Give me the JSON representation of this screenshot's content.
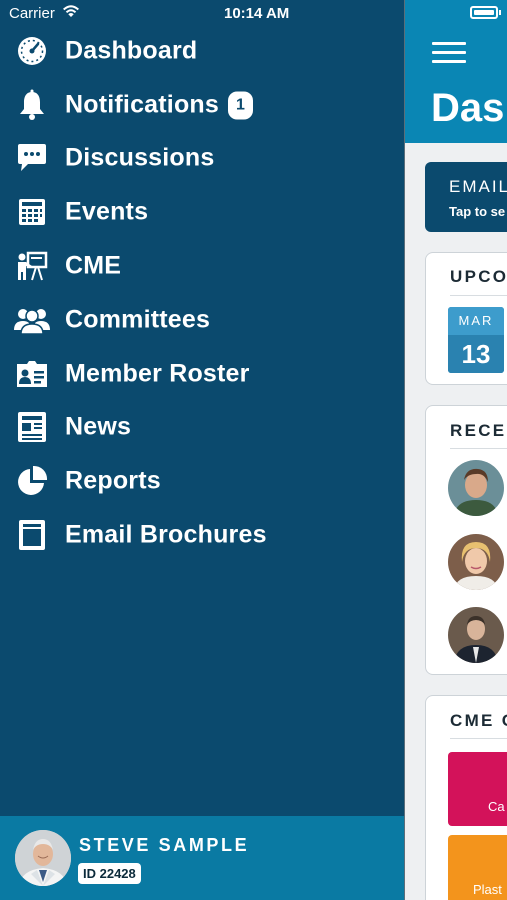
{
  "status_bar": {
    "carrier": "Carrier",
    "time": "10:14 AM"
  },
  "menu": {
    "items": [
      {
        "label": "Dashboard",
        "icon": "dashboard-gauge-icon"
      },
      {
        "label": "Notifications",
        "icon": "bell-icon",
        "badge": "1"
      },
      {
        "label": "Discussions",
        "icon": "chat-bubble-icon"
      },
      {
        "label": "Events",
        "icon": "calendar-icon"
      },
      {
        "label": "CME",
        "icon": "presentation-icon"
      },
      {
        "label": "Committees",
        "icon": "group-icon"
      },
      {
        "label": "Member Roster",
        "icon": "id-card-icon"
      },
      {
        "label": "News",
        "icon": "newspaper-icon"
      },
      {
        "label": "Reports",
        "icon": "pie-chart-icon"
      },
      {
        "label": "Email Brochures",
        "icon": "brochure-icon"
      }
    ]
  },
  "profile": {
    "name": "STEVE SAMPLE",
    "id_label": "ID 22428"
  },
  "panel": {
    "title": "Dash",
    "email_card": {
      "title": "EMAIL",
      "subtitle": "Tap to se"
    },
    "upcoming": {
      "title": "UPCO",
      "month": "MAR",
      "day": "13"
    },
    "recent": {
      "title": "RECEN"
    },
    "cme": {
      "title": "CME C",
      "tiles": [
        {
          "label": "Ca",
          "color": "#d3125a"
        },
        {
          "label": "Plast",
          "color": "#f3941c"
        }
      ]
    }
  },
  "colors": {
    "drawer_bg": "#0b4a6e",
    "profile_bg": "#0a7aa3",
    "header_bg": "#0a86b4",
    "panel_bg": "#eef0f2"
  }
}
